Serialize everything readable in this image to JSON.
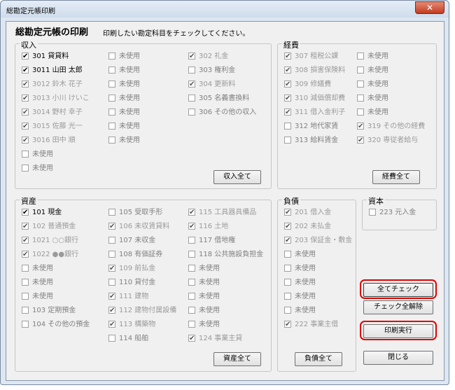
{
  "window": {
    "title": "総勘定元帳印刷",
    "close_glyph": "✕"
  },
  "header": {
    "title": "総勘定元帳の印刷",
    "subtitle": "印刷したい勘定科目をチェックしてください。"
  },
  "groups": {
    "income": "収入",
    "expense": "経費",
    "asset": "資産",
    "liability": "負債",
    "capital": "資本"
  },
  "income": {
    "items": [
      "301 貸貸料",
      "3011 山田 太郎",
      "3012 鈴木 花子",
      "3013 小川 けいこ",
      "3014 野村 幸子",
      "3015 佐藤 光一",
      "3016 田中 順",
      "未使用",
      "未使用",
      "未使用",
      "未使用",
      "未使用",
      "未使用",
      "未使用",
      "未使用",
      "未使用",
      "302 礼金",
      "303 権利金",
      "304 更新料",
      "305 名義書換料",
      "306 その他の収入"
    ],
    "button": "収入全て"
  },
  "expense": {
    "items": [
      "307 租税公課",
      "308 損害保険料",
      "309 修繕費",
      "310 減価償却費",
      "311 借入金利子",
      "312 地代家賃",
      "313 給料賃金",
      "未使用",
      "未使用",
      "未使用",
      "未使用",
      "未使用",
      "319 その他の経費",
      "320 専従者給与"
    ],
    "button": "経費全て"
  },
  "asset": {
    "items": [
      "101 現金",
      "102 普通預金",
      "1021 ○○銀行",
      "1022 ●●銀行",
      "未使用",
      "未使用",
      "未使用",
      "103 定期預金",
      "104 その他の預金",
      "105 受取手形",
      "106 未収賃貸料",
      "107 未収金",
      "108 有価証券",
      "109 前払金",
      "110 貸付金",
      "111 建物",
      "112 建物付属設備",
      "113 構築物",
      "114 船舶",
      "115 工具器具備品",
      "116 土地",
      "117 借地権",
      "118 公共施設負担金",
      "未使用",
      "未使用",
      "未使用",
      "未使用",
      "未使用",
      "124 事業主貸"
    ],
    "button": "資産全て"
  },
  "liability": {
    "items": [
      "201 借入金",
      "202 未払金",
      "203 保証金・敷金",
      "未使用",
      "未使用",
      "未使用",
      "未使用",
      "未使用",
      "222 事業主借"
    ],
    "button": "負債全て"
  },
  "capital": {
    "items": [
      "223 元入金"
    ]
  },
  "actions": {
    "check_all": "全てチェック",
    "uncheck_all": "チェック全解除",
    "print": "印刷実行",
    "close": "閉じる"
  },
  "colors": {
    "highlight": "#e00000",
    "client_bg": "#f0f0f0",
    "frame_bg": "#dce7f2"
  }
}
